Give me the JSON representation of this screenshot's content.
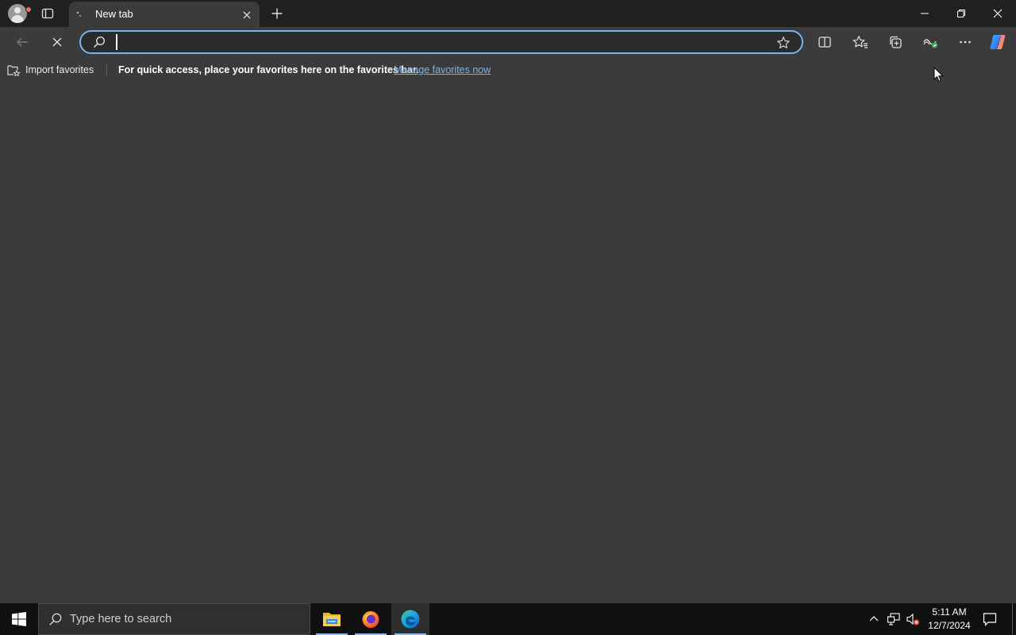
{
  "browser": {
    "tab": {
      "title": "New tab"
    },
    "address_bar": {
      "value": "",
      "placeholder": ""
    },
    "favorites_bar": {
      "import_label": "Import favorites",
      "message": "For quick access, place your favorites here on the favorites bar.",
      "link_label": "Manage favorites now"
    }
  },
  "taskbar": {
    "search_placeholder": "Type here to search",
    "clock": {
      "time": "5:11 AM",
      "date": "12/7/2024"
    }
  },
  "colors": {
    "accent": "#7ab3ea",
    "page_background": "#3b3b3b",
    "tab_strip": "#202020",
    "taskbar": "#101010"
  },
  "icons": [
    "profile-icon",
    "tab-actions-icon",
    "tab-favicon-icon",
    "close-icon",
    "plus-icon",
    "minimize-icon",
    "restore-icon",
    "window-close-icon",
    "back-arrow-icon",
    "stop-icon",
    "search-icon",
    "star-icon",
    "split-screen-icon",
    "favorites-icon",
    "collections-icon",
    "performance-icon",
    "more-icon",
    "copilot-icon",
    "import-favorites-icon",
    "windows-logo-icon",
    "file-explorer-icon",
    "firefox-icon",
    "edge-icon",
    "chevron-up-icon",
    "network-icon",
    "volume-muted-icon",
    "notification-icon"
  ]
}
